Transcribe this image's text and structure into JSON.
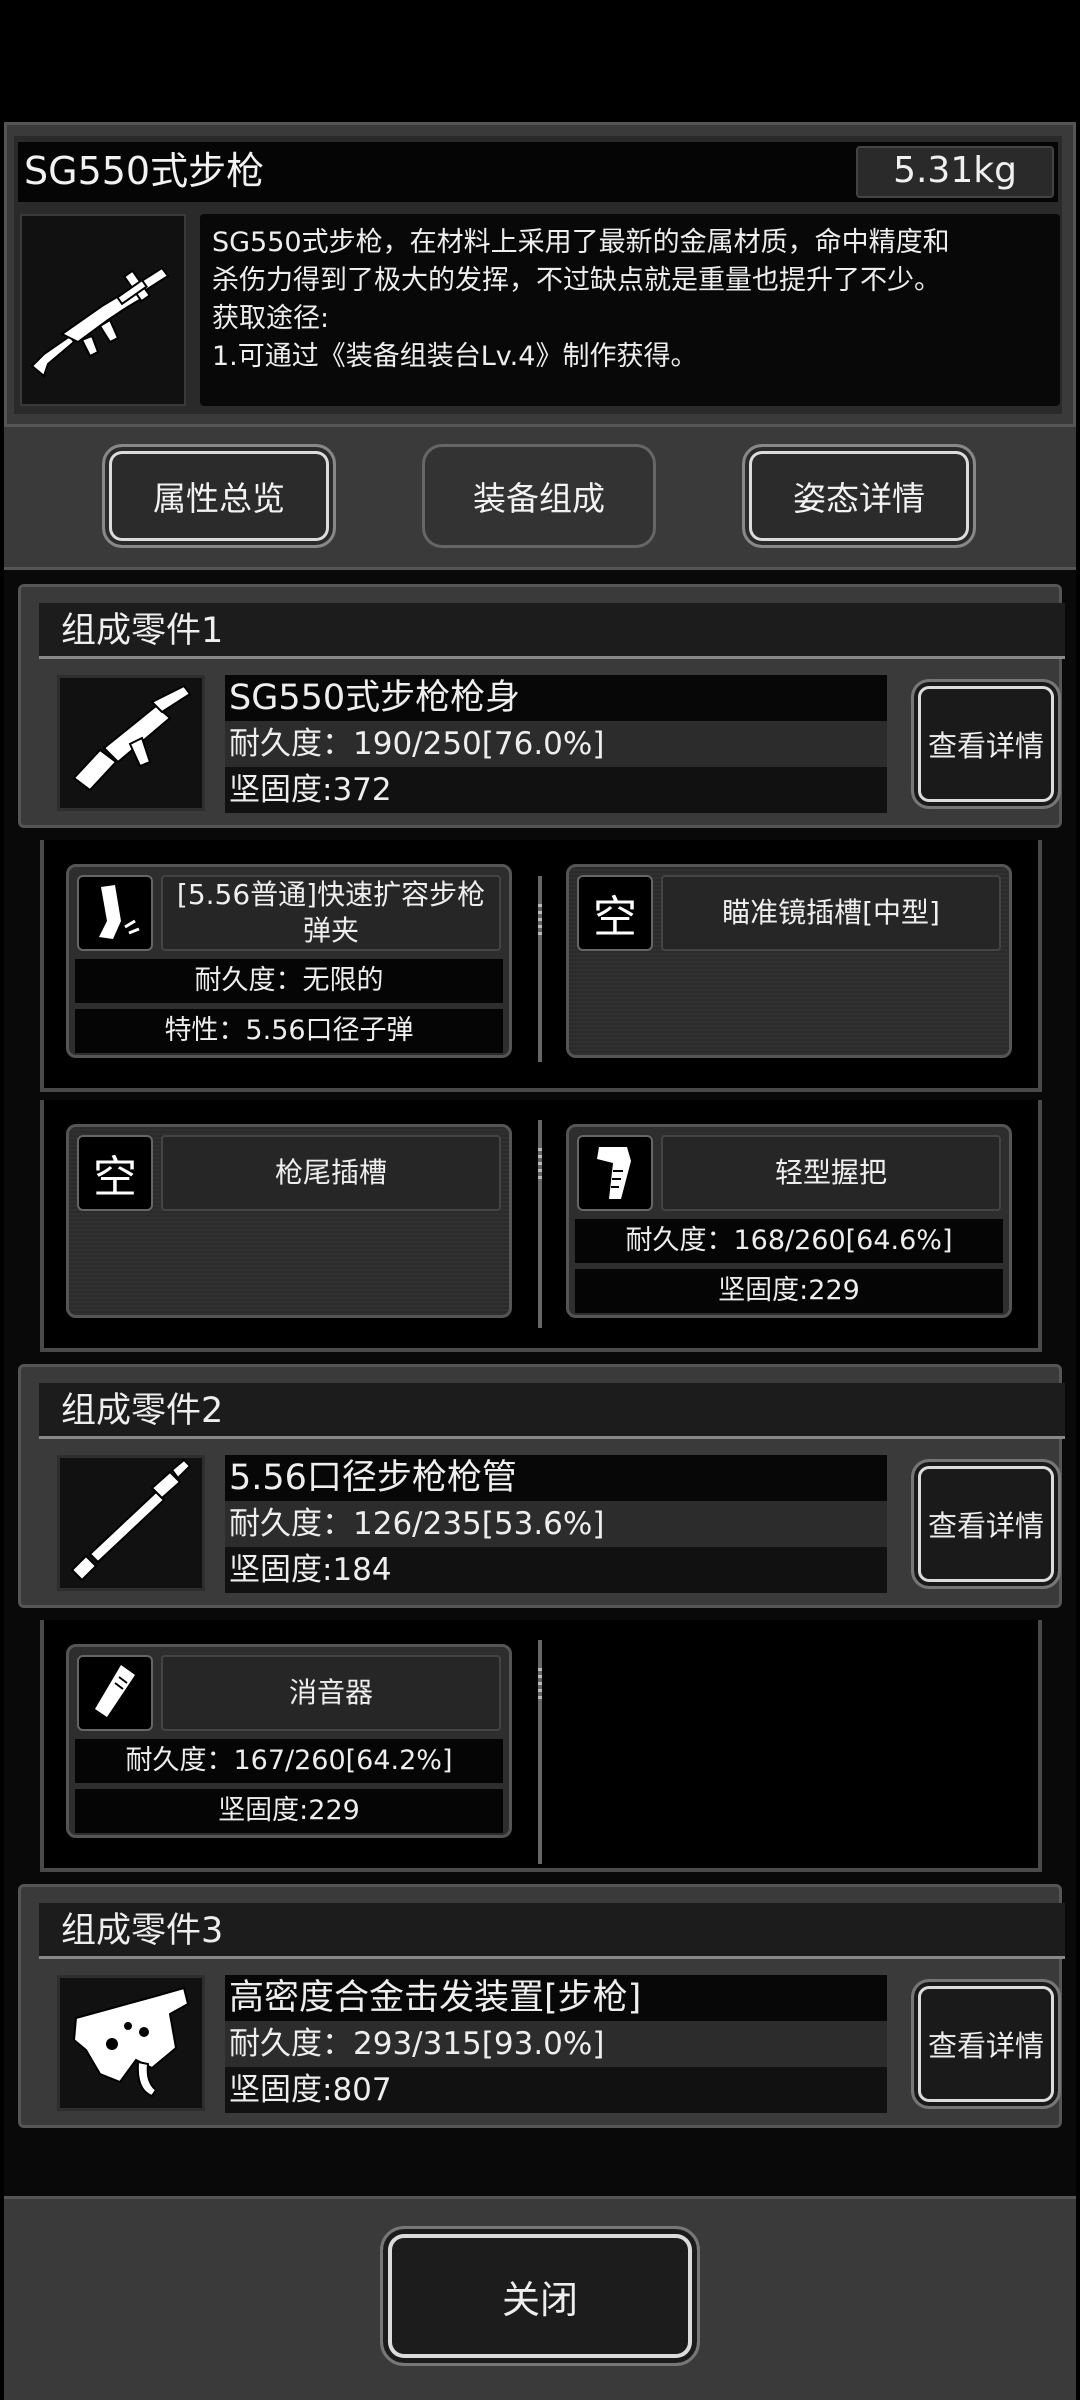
{
  "header": {
    "title": "SG550式步枪",
    "weight": "5.31kg",
    "description": [
      "SG550式步枪，在材料上采用了最新的金属材质，命中精度和",
      "杀伤力得到了极大的发挥，不过缺点就是重量也提升了不少。",
      "获取途径:",
      "1.可通过《装备组装台Lv.4》制作获得。"
    ],
    "icon": "rifle-icon"
  },
  "tabs": [
    {
      "label": "属性总览"
    },
    {
      "label": "装备组成"
    },
    {
      "label": "姿态详情"
    }
  ],
  "parts": [
    {
      "header": "组成零件1",
      "name": "SG550式步枪枪身",
      "durability": "耐久度：190/250[76.0%]",
      "hardness": "坚固度:372",
      "detail_label": "查看详情",
      "icon": "rifle-body-icon"
    },
    {
      "header": "组成零件2",
      "name": "5.56口径步枪枪管",
      "durability": "耐久度：126/235[53.6%]",
      "hardness": "坚固度:184",
      "detail_label": "查看详情",
      "icon": "barrel-icon"
    },
    {
      "header": "组成零件3",
      "name": "高密度合金击发装置[步枪]",
      "durability": "耐久度：293/315[93.0%]",
      "hardness": "坚固度:807",
      "detail_label": "查看详情",
      "icon": "trigger-mechanism-icon"
    }
  ],
  "slots": {
    "magazine": {
      "name": "[5.56普通]快速扩容步枪弹夹",
      "stat1": "耐久度：无限的",
      "stat2": "特性：5.56口径子弹",
      "icon": "magazine-icon"
    },
    "scope": {
      "name": "瞄准镜插槽[中型]",
      "empty_label": "空"
    },
    "stock": {
      "name": "枪尾插槽",
      "empty_label": "空"
    },
    "grip": {
      "name": "轻型握把",
      "stat1": "耐久度：168/260[64.6%]",
      "stat2": "坚固度:229",
      "icon": "grip-icon"
    },
    "suppressor": {
      "name": "消音器",
      "stat1": "耐久度：167/260[64.2%]",
      "stat2": "坚固度:229",
      "icon": "suppressor-icon"
    }
  },
  "footer": {
    "close_label": "关闭"
  }
}
